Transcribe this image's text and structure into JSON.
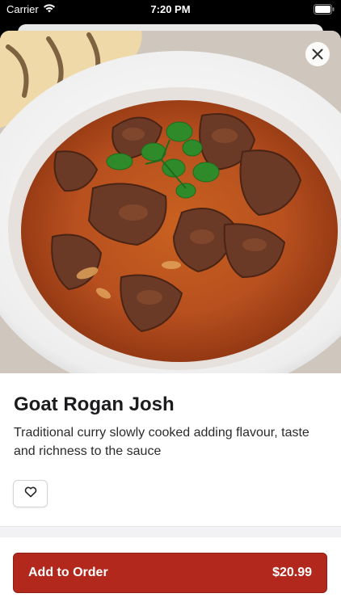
{
  "status_bar": {
    "carrier": "Carrier",
    "time": "7:20 PM"
  },
  "dish": {
    "title": "Goat Rogan Josh",
    "description": "Traditional curry slowly cooked adding flavour, taste and richness to the sauce"
  },
  "order_button": {
    "label": "Add to Order",
    "price": "$20.99"
  },
  "icons": {
    "close": "close-icon",
    "favorite": "heart-icon",
    "wifi": "wifi-icon",
    "battery": "battery-icon"
  },
  "colors": {
    "accent": "#b3281d",
    "curry": "#b8501f"
  }
}
